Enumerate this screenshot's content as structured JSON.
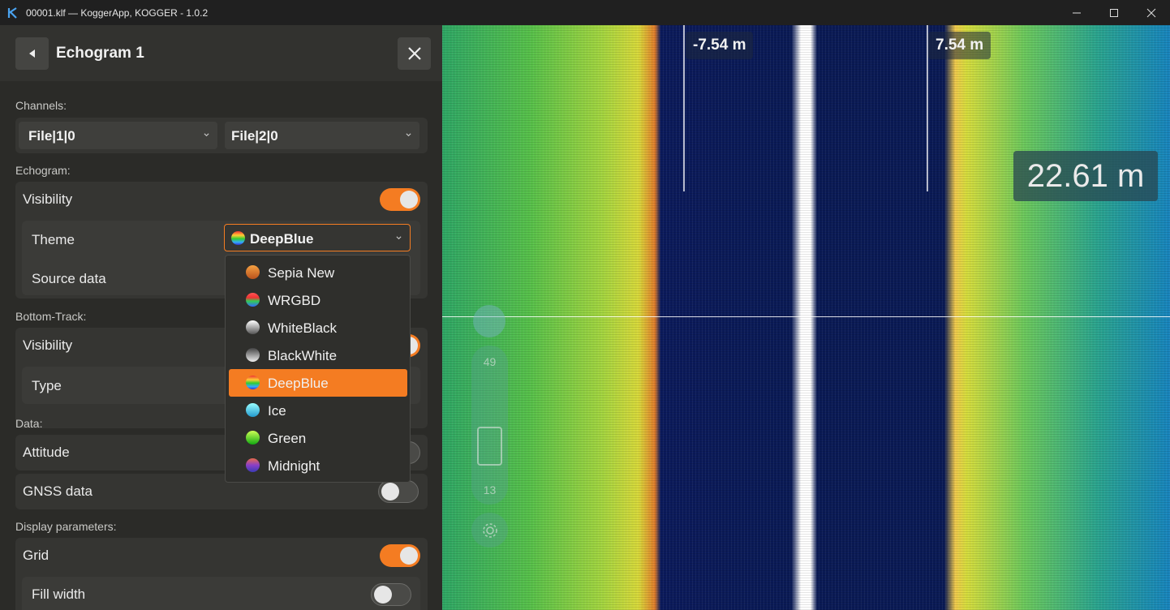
{
  "window": {
    "title": "00001.klf — KoggerApp, KOGGER - 1.0.2",
    "controls": [
      "minimize",
      "maximize",
      "close"
    ]
  },
  "panel": {
    "title": "Echogram 1",
    "sections": {
      "channels": "Channels:",
      "echogram": "Echogram:",
      "bottom_track": "Bottom-Track:",
      "data": "Data:",
      "display": "Display parameters:"
    },
    "channels": {
      "channel1": "File|1|0",
      "channel2": "File|2|0"
    },
    "echogram": {
      "visibility_label": "Visibility",
      "visibility_on": true,
      "theme_label": "Theme",
      "theme_value": "DeepBlue",
      "source_label": "Source data"
    },
    "bottom_track": {
      "visibility_label": "Visibility",
      "type_label": "Type"
    },
    "data": {
      "attitude_label": "Attitude",
      "attitude_on": false,
      "gnss_label": "GNSS data",
      "gnss_on": false
    },
    "display": {
      "grid_label": "Grid",
      "grid_on": true,
      "fill_width_label": "Fill width",
      "fill_width_on": false
    }
  },
  "theme_popup": {
    "items": [
      {
        "label": "Sepia New",
        "icon": "sepia-gradient"
      },
      {
        "label": "WRGBD",
        "icon": "wrgbd-gradient"
      },
      {
        "label": "WhiteBlack",
        "icon": "whiteblack-gradient"
      },
      {
        "label": "BlackWhite",
        "icon": "blackwhite-gradient"
      },
      {
        "label": "DeepBlue",
        "icon": "deepblue-gradient",
        "selected": true
      },
      {
        "label": "Ice",
        "icon": "ice-gradient"
      },
      {
        "label": "Green",
        "icon": "green-gradient"
      },
      {
        "label": "Midnight",
        "icon": "midnight-gradient"
      }
    ]
  },
  "echogram_view": {
    "left_distance": "-7.54 m",
    "right_distance": "7.54 m",
    "depth": "22.61 m",
    "slider_max": "49",
    "slider_min": "13"
  },
  "colors": {
    "accent": "#f47c22",
    "panel_bg": "#2b2b28",
    "deep_blue": "#0a1a55"
  }
}
